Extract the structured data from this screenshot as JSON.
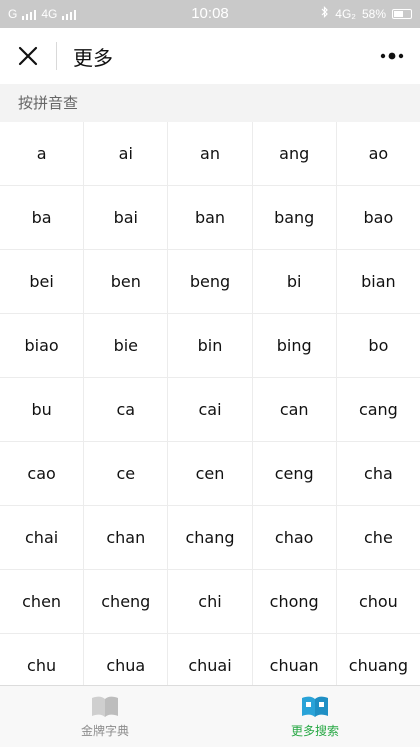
{
  "status_bar": {
    "carrier1": "G",
    "carrier2": "4G",
    "time": "10:08",
    "network": "4G₂",
    "battery": "58%"
  },
  "nav": {
    "title": "更多",
    "close_icon": "close-icon",
    "more_icon": "more-dots-icon"
  },
  "section": {
    "title": "按拼音查"
  },
  "pinyin": [
    "a",
    "ai",
    "an",
    "ang",
    "ao",
    "ba",
    "bai",
    "ban",
    "bang",
    "bao",
    "bei",
    "ben",
    "beng",
    "bi",
    "bian",
    "biao",
    "bie",
    "bin",
    "bing",
    "bo",
    "bu",
    "ca",
    "cai",
    "can",
    "cang",
    "cao",
    "ce",
    "cen",
    "ceng",
    "cha",
    "chai",
    "chan",
    "chang",
    "chao",
    "che",
    "chen",
    "cheng",
    "chi",
    "chong",
    "chou",
    "chu",
    "chua",
    "chuai",
    "chuan",
    "chuang"
  ],
  "tabs": [
    {
      "label": "金牌字典",
      "icon": "book-icon",
      "active": false
    },
    {
      "label": "更多搜索",
      "icon": "dictionary-book-icon",
      "active": true
    }
  ],
  "colors": {
    "accent": "#27a844",
    "book_active": "#2aa3d8",
    "book_inactive": "#cfcfcf"
  }
}
